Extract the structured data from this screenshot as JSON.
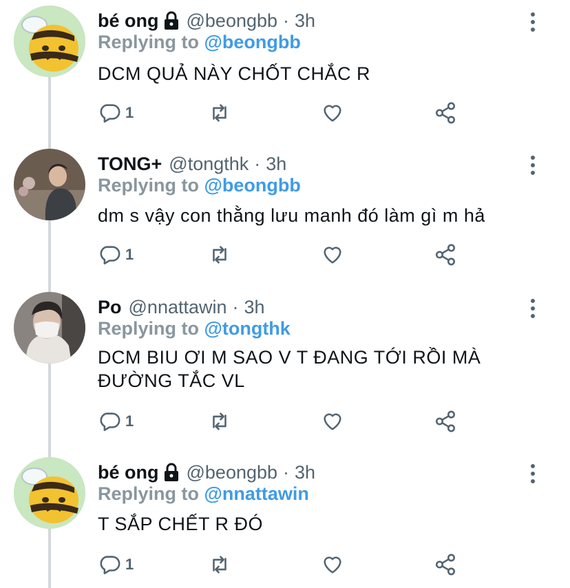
{
  "tweets": [
    {
      "name": "bé ong",
      "locked": true,
      "handle": "@beongbb",
      "sep": "·",
      "time": "3h",
      "replying_prefix": "Replying to",
      "replying_to": "@beongbb",
      "lines": [
        "DCM QUẢ NÀY CHỐT CHẮC R"
      ],
      "reply_count": "1",
      "avatar": "bee-avatar"
    },
    {
      "name": "TONG+",
      "locked": false,
      "handle": "@tongthk",
      "sep": "·",
      "time": "3h",
      "replying_prefix": "Replying to",
      "replying_to": "@beongbb",
      "lines": [
        "dm s vậy con thằng lưu manh đó làm gì m hả"
      ],
      "reply_count": "1",
      "avatar": "photo-avatar"
    },
    {
      "name": "Po",
      "locked": false,
      "handle": "@nnattawin",
      "sep": "·",
      "time": "3h",
      "replying_prefix": "Replying to",
      "replying_to": "@tongthk",
      "lines": [
        "DCM BIU ƠI M SAO V T ĐANG TỚI RỒI MÀ",
        "ĐƯỜNG TẮC VL"
      ],
      "reply_count": "1",
      "avatar": "masked-person-avatar"
    },
    {
      "name": "bé ong",
      "locked": true,
      "handle": "@beongbb",
      "sep": "·",
      "time": "3h",
      "replying_prefix": "Replying to",
      "replying_to": "@nnattawin",
      "lines": [
        "T SẮP CHẾT R ĐÓ"
      ],
      "reply_count": "1",
      "avatar": "bee-avatar"
    }
  ],
  "icons": {
    "reply": "comment-icon",
    "retweet": "retweet-icon",
    "like": "heart-icon",
    "share": "share-icon",
    "more": "more-icon",
    "lock": "lock-icon"
  },
  "colors": {
    "link": "#3f9be6",
    "muted": "#536471",
    "replying_prefix": "#8a969f"
  }
}
